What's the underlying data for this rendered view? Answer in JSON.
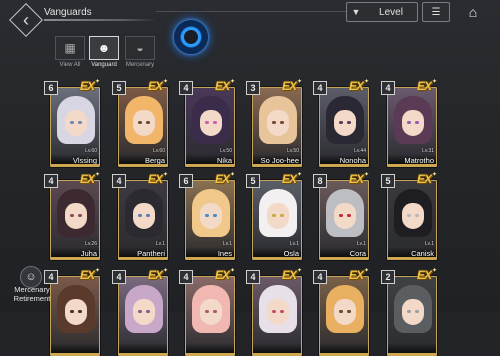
{
  "header": {
    "title": "Vanguards",
    "back_icon": "back-arrow-icon",
    "level_button": {
      "label": "Level",
      "icon": "filter-icon"
    },
    "sort_icon": "sort-icon",
    "home_icon": "home-icon"
  },
  "tabs": [
    {
      "label": "View All",
      "icon": "grid-icon",
      "active": false
    },
    {
      "label": "Vanguard",
      "icon": "vanguard-icon",
      "active": true
    },
    {
      "label": "Mercenary",
      "icon": "helmet-icon",
      "active": false
    }
  ],
  "rows": [
    [
      {
        "name": "Vlssing",
        "stars": "6",
        "level": "Lv.60",
        "hair": "#d9d6e3",
        "bg": "#6a6f7b",
        "eye": "#6f86b8"
      },
      {
        "name": "Berga",
        "stars": "5",
        "level": "Lv.60",
        "hair": "#f2b66a",
        "bg": "#7c5a45",
        "eye": "#6a4a2a"
      },
      {
        "name": "Nika",
        "stars": "4",
        "level": "Lv.50",
        "hair": "#3a2c4a",
        "bg": "#4a3858",
        "eye": "#d45ab0"
      },
      {
        "name": "So Joo-hee",
        "stars": "3",
        "level": "Lv.50",
        "hair": "#e8c49a",
        "bg": "#8a6a52",
        "eye": "#7a4a30"
      },
      {
        "name": "Nonoha",
        "stars": "4",
        "level": "Lv.44",
        "hair": "#2a2832",
        "bg": "#5c5c6a",
        "eye": "#5a3a5a"
      },
      {
        "name": "Matrotho",
        "stars": "4",
        "level": "Lv.31",
        "hair": "#5a3a54",
        "bg": "#6a5a6e",
        "eye": "#9a5aa8"
      }
    ],
    [
      {
        "name": "Juha",
        "stars": "4",
        "level": "Lv.26",
        "hair": "#3c2a30",
        "bg": "#5a4a50",
        "eye": "#8a4a5a"
      },
      {
        "name": "Pantheri",
        "stars": "4",
        "level": "Lv.1",
        "hair": "#2a2a30",
        "bg": "#3c3a40",
        "eye": "#5a7ab8"
      },
      {
        "name": "Ines",
        "stars": "6",
        "level": "Lv.1",
        "hair": "#f0c88a",
        "bg": "#8a7050",
        "eye": "#4a8ac8"
      },
      {
        "name": "Osla",
        "stars": "5",
        "level": "Lv.1",
        "hair": "#f2f0f0",
        "bg": "#5a5e68",
        "eye": "#c8a83a"
      },
      {
        "name": "Cora",
        "stars": "8",
        "level": "Lv.1",
        "hair": "#bdbdc4",
        "bg": "#6a5a5a",
        "eye": "#c8283a"
      },
      {
        "name": "Canisk",
        "stars": "5",
        "level": "Lv.1",
        "hair": "#1e1e22",
        "bg": "#3a3a3e",
        "eye": "#b8b8b8"
      }
    ],
    [
      {
        "name": "",
        "stars": "4",
        "level": "",
        "hair": "#5a3a2a",
        "bg": "#7a5a4a",
        "eye": "#4a3020"
      },
      {
        "name": "",
        "stars": "4",
        "level": "",
        "hair": "#c8a8c8",
        "bg": "#7a6a7e",
        "eye": "#8a5a8a"
      },
      {
        "name": "",
        "stars": "4",
        "level": "",
        "hair": "#f0b8b0",
        "bg": "#8a6a68",
        "eye": "#a85a6a"
      },
      {
        "name": "",
        "stars": "4",
        "level": "",
        "hair": "#e8e0e8",
        "bg": "#6a5a68",
        "eye": "#c84a6a"
      },
      {
        "name": "",
        "stars": "4",
        "level": "",
        "hair": "#e8b060",
        "bg": "#7a6048",
        "eye": "#6a4a2a"
      },
      {
        "name": "",
        "stars": "2",
        "level": "",
        "hair": "#5a5e60",
        "bg": "#3e4244",
        "eye": "#9aa0a0"
      }
    ]
  ],
  "ex_label": "EX",
  "retirement": {
    "label": "Mercenary Retirement",
    "icon": "mercenary-retirement-icon"
  }
}
